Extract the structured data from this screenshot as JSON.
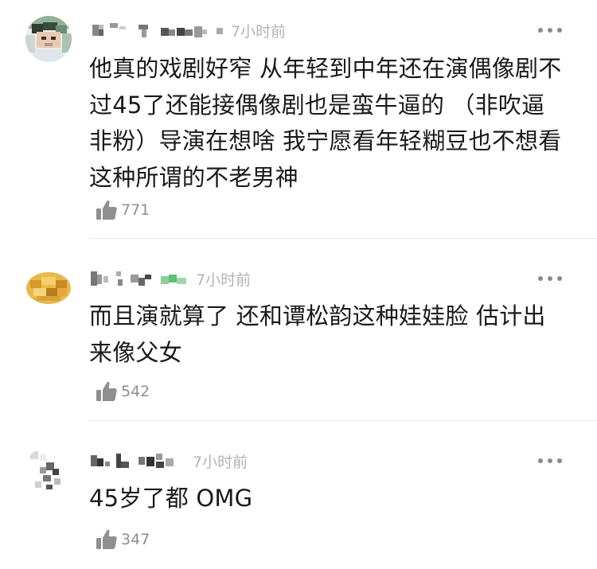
{
  "comments": [
    {
      "time": "7小时前",
      "text": "他真的戏剧好窄 从年轻到中年还在演偶像剧不过45了还能接偶像剧也是蛮牛逼的 （非吹逼非粉）导演在想啥 我宁愿看年轻糊豆也不想看这种所谓的不老男神",
      "like_icon": "thumbs-up-icon",
      "likes": "771",
      "more_icon": "more-dots-icon"
    },
    {
      "time": "7小时前",
      "text": "而且演就算了 还和谭松韵这种娃娃脸 估计出来像父女",
      "like_icon": "thumbs-up-icon",
      "likes": "542",
      "more_icon": "more-dots-icon"
    },
    {
      "time": "7小时前",
      "text": "45岁了都 OMG",
      "like_icon": "thumbs-up-icon",
      "likes": "347",
      "more_icon": "more-dots-icon"
    }
  ]
}
